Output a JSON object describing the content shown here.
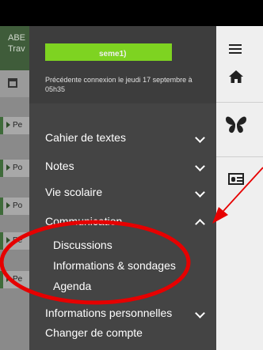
{
  "background_app": {
    "header_text_line1": "ABE",
    "header_text_line2": "Trav",
    "rows": [
      "Pe",
      "Po",
      "Po",
      "Pe",
      "Pe"
    ]
  },
  "drawer": {
    "username_fragment": "seme1)",
    "last_connection": "Précédente connexion le jeudi 17 septembre à 05h35",
    "menu": [
      {
        "label": "Cahier de textes",
        "expanded": false
      },
      {
        "label": "Notes",
        "expanded": false
      },
      {
        "label": "Vie scolaire",
        "expanded": false
      },
      {
        "label": "Communication",
        "expanded": true
      },
      {
        "label": "Informations personnelles",
        "expanded": false
      }
    ],
    "submenu": [
      "Discussions",
      "Informations & sondages",
      "Agenda"
    ],
    "switch_account": "Changer de compte"
  },
  "rail": {
    "icons": [
      "menu-icon",
      "home-icon",
      "butterfly-icon",
      "id-card-icon"
    ]
  },
  "colors": {
    "drawer_bg": "#444444",
    "highlight_name": "#7ed321",
    "annotation": "#e60000",
    "app_green": "#3f5c3a"
  }
}
